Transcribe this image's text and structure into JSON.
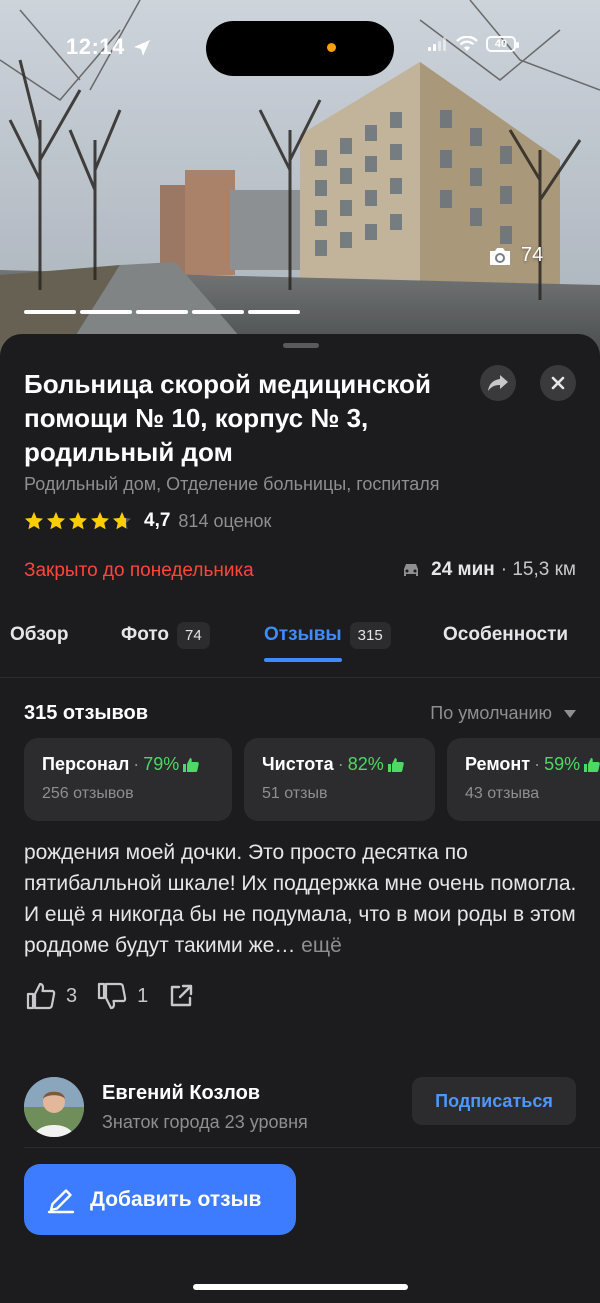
{
  "status_bar": {
    "time": "12:14",
    "battery": "40"
  },
  "photo": {
    "count": "74",
    "camera_icon": "camera-icon",
    "segments_total": 5,
    "segments_viewed": 5
  },
  "place": {
    "title": "Больница скорой медицинской помощи № 10, корпус № 3, родильный дом",
    "category": "Родильный дом, Отделение больницы, госпиталя",
    "rating": "4,7",
    "rating_stars": 4.7,
    "rating_count": "814 оценок",
    "hours_status": "Закрыто до понедельника",
    "route_time": "24 мин",
    "route_distance": "· 15,3 км"
  },
  "tabs": [
    {
      "label": "Обзор",
      "badge": ""
    },
    {
      "label": "Фото",
      "badge": "74"
    },
    {
      "label": "Отзывы",
      "badge": "315",
      "active": true
    },
    {
      "label": "Особенности",
      "badge": ""
    }
  ],
  "reviews": {
    "count_label": "315 отзывов",
    "sort_label": "По умолчанию",
    "aspects": [
      {
        "name": "Персонал",
        "percent": "79%",
        "count": "256 отзывов"
      },
      {
        "name": "Чистота",
        "percent": "82%",
        "count": "51 отзыв"
      },
      {
        "name": "Ремонт",
        "percent": "59%",
        "count": "43 отзыва"
      }
    ],
    "current": {
      "text": "рождения моей дочки. Это просто десятка по пятибалльной шкале! Их поддержка мне очень помогла. И ещё я никогда бы не подумала, что в мои роды в этом роддоме будут такими же…",
      "more": "ещё",
      "likes": "3",
      "dislikes": "1"
    },
    "next_author": {
      "name": "Евгений Козлов",
      "level": "Знаток города 23 уровня",
      "subscribe_label": "Подписаться"
    }
  },
  "add_review_label": "Добавить отзыв",
  "colors": {
    "accent": "#3d7bff",
    "closed": "#ff453a",
    "positive": "#4cd964",
    "star": "#ffcc00"
  }
}
